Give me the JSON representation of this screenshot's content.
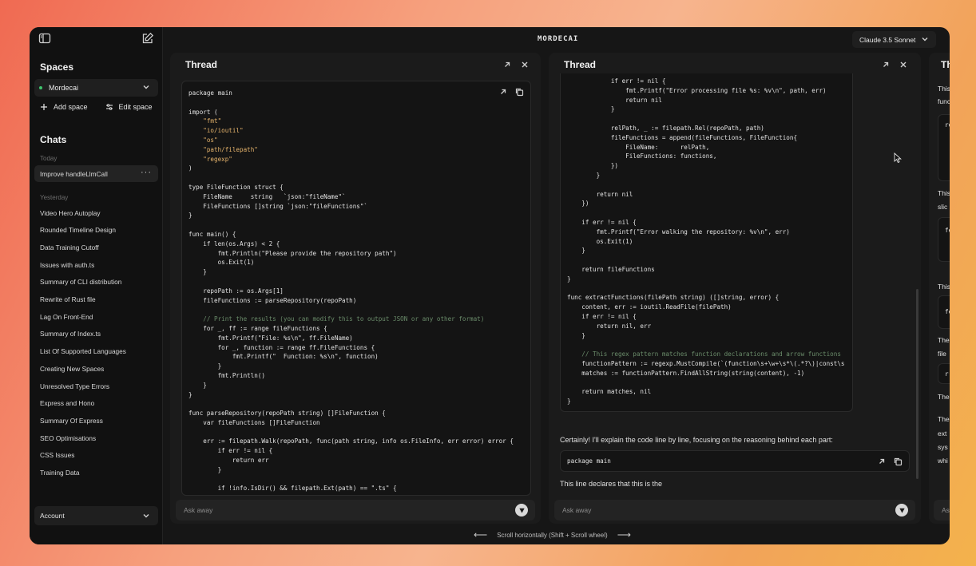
{
  "app": {
    "title": "MORDECAI"
  },
  "model_selector": {
    "label": "Claude 3.5 Sonnet"
  },
  "sidebar": {
    "spaces_heading": "Spaces",
    "current_space": "Mordecai",
    "add_space": "Add space",
    "edit_space": "Edit space",
    "chats_heading": "Chats",
    "today_label": "Today",
    "today_items": [
      "Improve handleLlmCall"
    ],
    "yesterday_label": "Yesterday",
    "yesterday_items": [
      "Video Hero Autoplay",
      "Rounded Timeline Design",
      "Data Training Cutoff",
      "Issues with auth.ts",
      "Summary of CLI distribution",
      "Rewrite of Rust file",
      "Lag On Front-End",
      "Summary of Index.ts",
      "List Of Supported Languages",
      "Creating New Spaces",
      "Unresolved Type Errors",
      "Express and Hono",
      "Summary Of Express",
      "SEO Optimisations",
      "CSS Issues",
      "Training Data"
    ],
    "account_label": "Account"
  },
  "threads": [
    {
      "title": "Thread",
      "ask_placeholder": "Ask away",
      "code": [
        "package main",
        "",
        "import (",
        "    \"fmt\"",
        "    \"io/ioutil\"",
        "    \"os\"",
        "    \"path/filepath\"",
        "    \"regexp\"",
        ")",
        "",
        "type FileFunction struct {",
        "    FileName     string   `json:\"fileName\"`",
        "    FileFunctions []string `json:\"fileFunctions\"`",
        "}",
        "",
        "func main() {",
        "    if len(os.Args) < 2 {",
        "        fmt.Println(\"Please provide the repository path\")",
        "        os.Exit(1)",
        "    }",
        "",
        "    repoPath := os.Args[1]",
        "    fileFunctions := parseRepository(repoPath)",
        "",
        "    // Print the results (you can modify this to output JSON or any other format)",
        "    for _, ff := range fileFunctions {",
        "        fmt.Printf(\"File: %s\\n\", ff.FileName)",
        "        for _, function := range ff.FileFunctions {",
        "            fmt.Printf(\"  Function: %s\\n\", function)",
        "        }",
        "        fmt.Println()",
        "    }",
        "}",
        "",
        "func parseRepository(repoPath string) []FileFunction {",
        "    var fileFunctions []FileFunction",
        "",
        "    err := filepath.Walk(repoPath, func(path string, info os.FileInfo, err error) error {",
        "        if err != nil {",
        "            return err",
        "        }",
        "",
        "        if !info.IsDir() && filepath.Ext(path) == \".ts\" {"
      ]
    },
    {
      "title": "Thread",
      "ask_placeholder": "Ask away",
      "code": [
        "            if err != nil {",
        "                fmt.Printf(\"Error processing file %s: %v\\n\", path, err)",
        "                return nil",
        "            }",
        "",
        "            relPath, _ := filepath.Rel(repoPath, path)",
        "            fileFunctions = append(fileFunctions, FileFunction{",
        "                FileName:      relPath,",
        "                FileFunctions: functions,",
        "            })",
        "        }",
        "",
        "        return nil",
        "    })",
        "",
        "    if err != nil {",
        "        fmt.Printf(\"Error walking the repository: %v\\n\", err)",
        "        os.Exit(1)",
        "    }",
        "",
        "    return fileFunctions",
        "}",
        "",
        "func extractFunctions(filePath string) ([]string, error) {",
        "    content, err := ioutil.ReadFile(filePath)",
        "    if err != nil {",
        "        return nil, err",
        "    }",
        "",
        "    // This regex pattern matches function declarations and arrow functions",
        "    functionPattern := regexp.MustCompile(`(function\\s+\\w+\\s*\\(.*?\\)|const\\s",
        "    matches := functionPattern.FindAllString(string(content), -1)",
        "",
        "    return matches, nil",
        "}"
      ],
      "explanation": "Certainly! I'll explain the code line by line, focusing on the reasoning behind each part:",
      "snippet": "package main",
      "snippet_note": "This line declares that this is the"
    },
    {
      "title": "Th",
      "ask_placeholder": "Ask",
      "fragments": [
        "This",
        "func",
        "re",
        "This",
        "slic",
        "fe",
        "This",
        "fe",
        "The",
        "file",
        "r",
        "The",
        "The",
        "ext",
        "sys",
        "whi"
      ]
    }
  ],
  "footer": {
    "scroll_hint": "Scroll horizontally (Shift + Scroll wheel)"
  }
}
